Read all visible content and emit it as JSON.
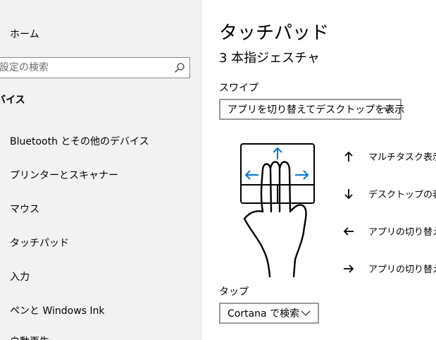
{
  "sidebar": {
    "home_label": "ホーム",
    "search_placeholder": "設定の検索",
    "section_title": "バイス",
    "items": [
      {
        "label": "Bluetooth とその他のデバイス"
      },
      {
        "label": "プリンターとスキャナー"
      },
      {
        "label": "マウス"
      },
      {
        "label": "タッチパッド"
      },
      {
        "label": "入力"
      },
      {
        "label": "ペンと Windows Ink"
      },
      {
        "label": "自動再生"
      }
    ]
  },
  "main": {
    "title": "タッチパッド",
    "subtitle": "3 本指ジェスチャ",
    "swipe": {
      "label": "スワイプ",
      "selected": "アプリを切り替えてデスクトップを表示"
    },
    "gestures": [
      {
        "icon": "arrow-up-icon",
        "label": "マルチタスク表示"
      },
      {
        "icon": "arrow-down-icon",
        "label": "デスクトップの表示"
      },
      {
        "icon": "arrow-left-icon",
        "label": "アプリの切り替え"
      },
      {
        "icon": "arrow-right-icon",
        "label": "アプリの切り替え"
      }
    ],
    "tap": {
      "label": "タップ",
      "selected": "Cortana で検索"
    }
  },
  "colors": {
    "sidebar_bg": "#f2f2f2",
    "accent": "#0078d7"
  }
}
